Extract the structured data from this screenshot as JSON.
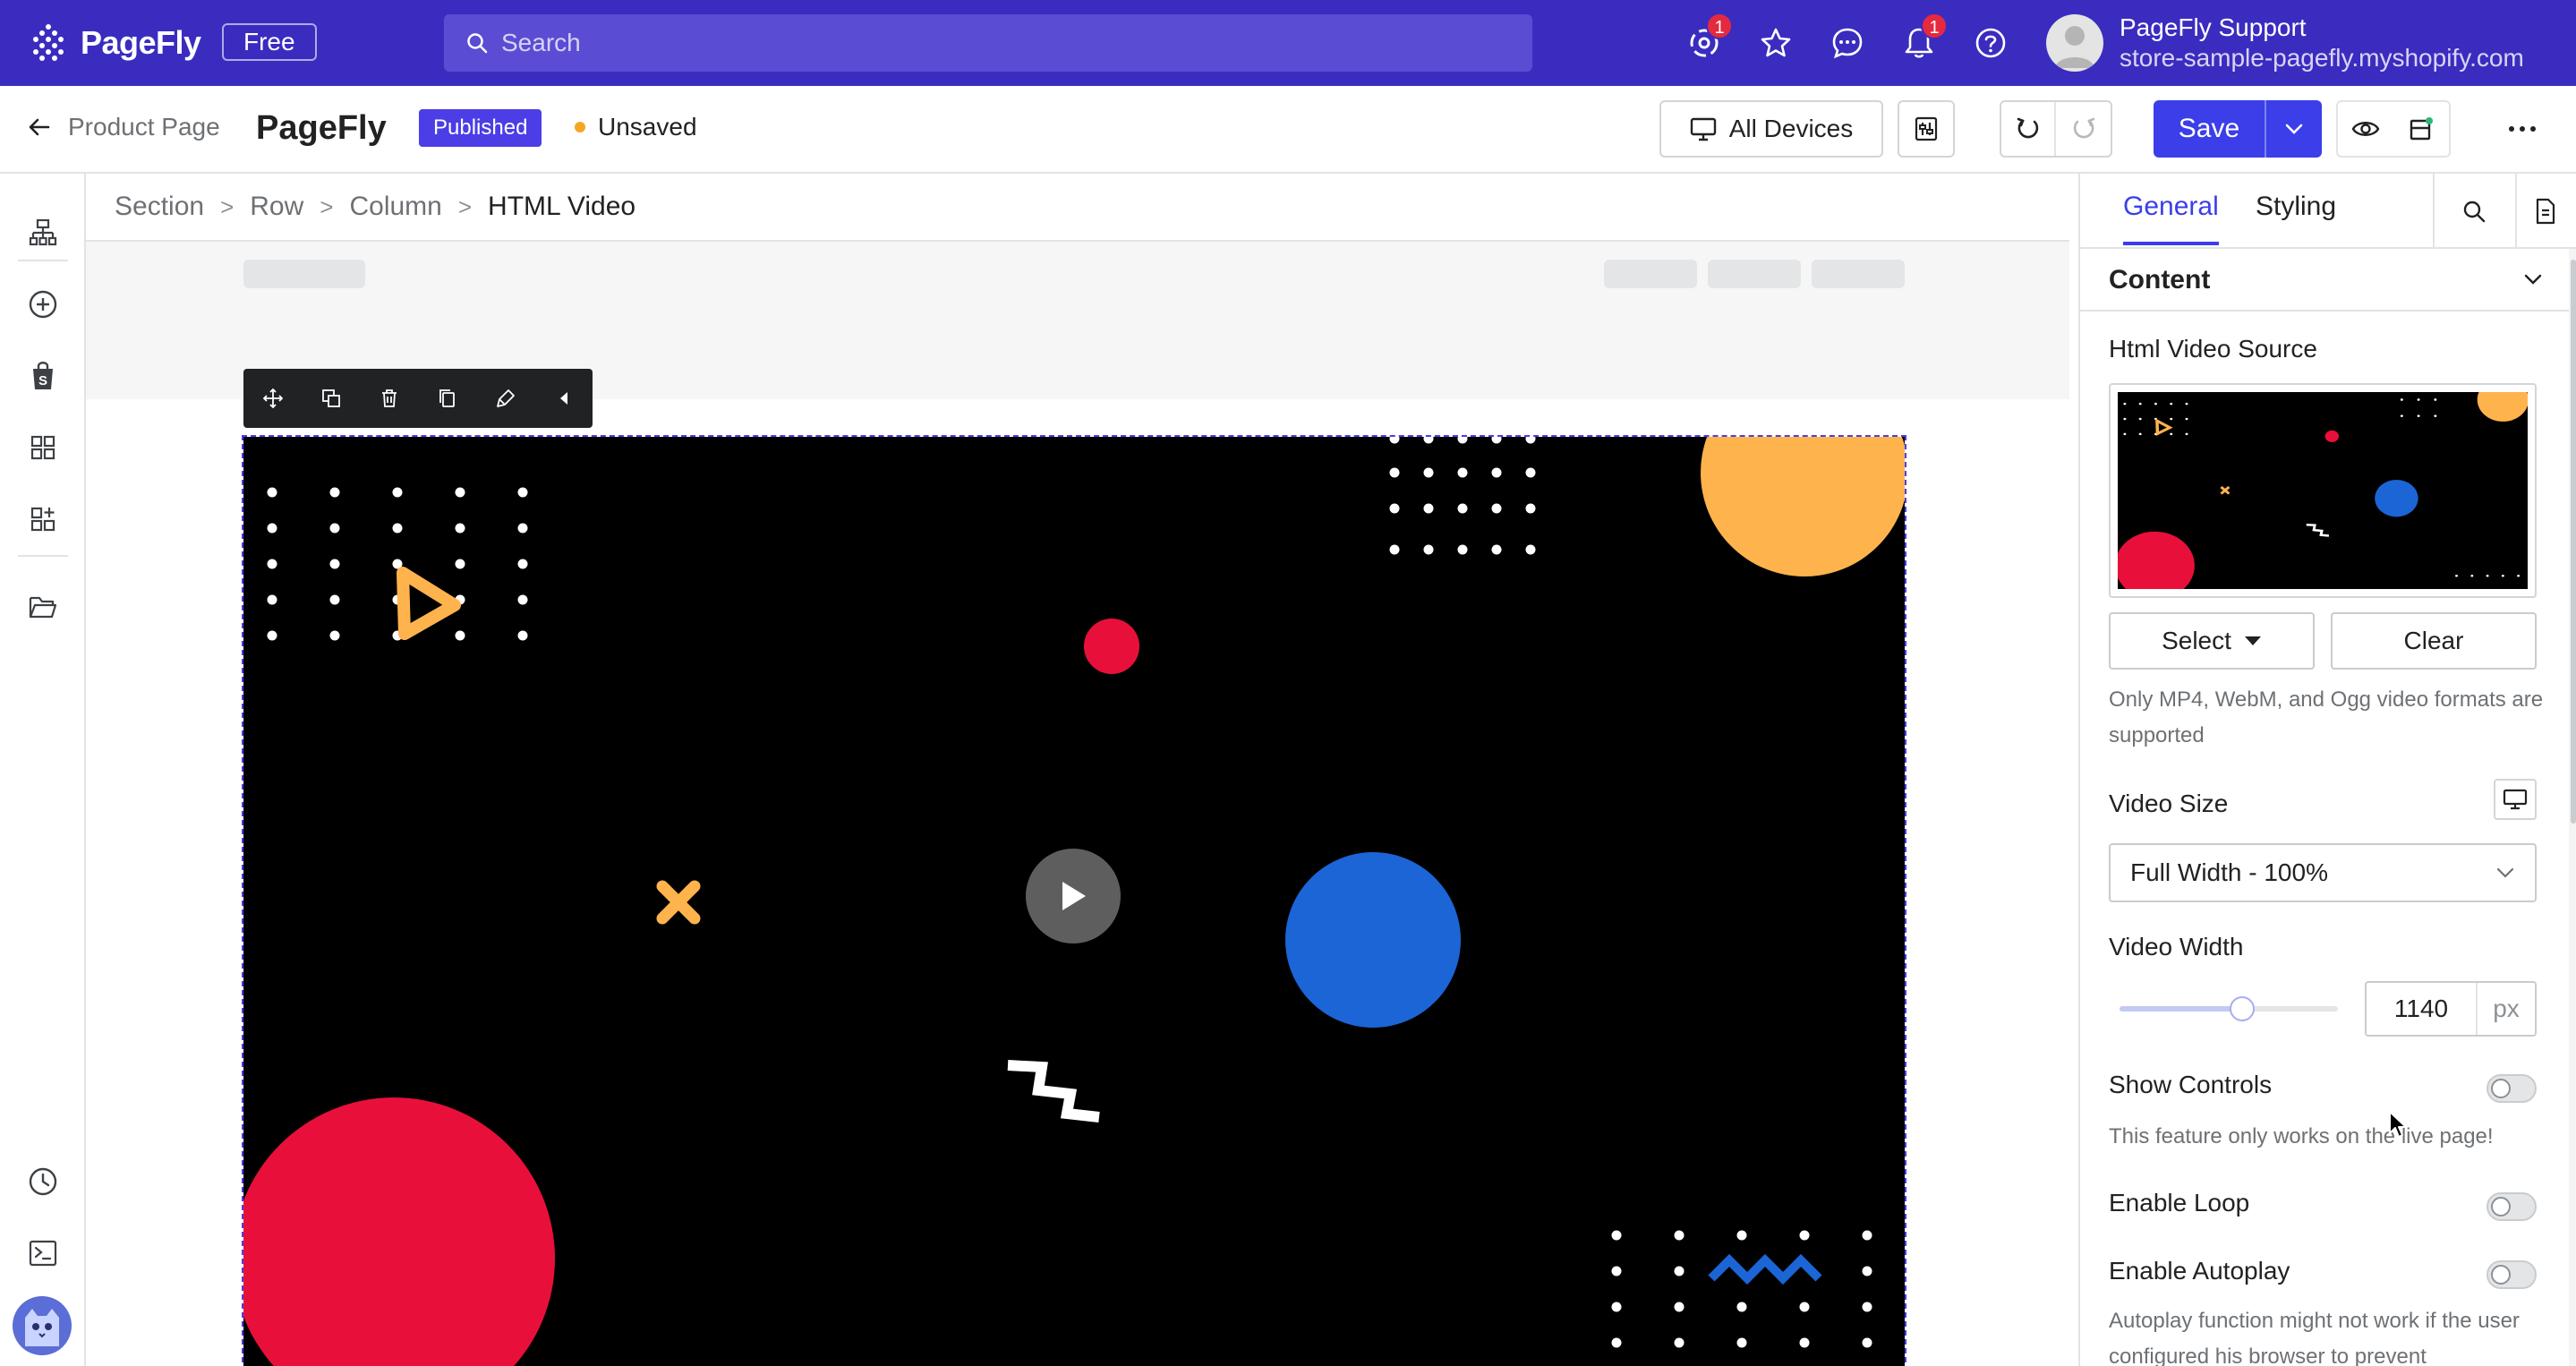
{
  "topbar": {
    "brand": "PageFly",
    "plan": "Free",
    "search_placeholder": "Search",
    "icons": [
      {
        "name": "apps-icon",
        "badge": "1"
      },
      {
        "name": "star-icon"
      },
      {
        "name": "chat-icon"
      },
      {
        "name": "bell-icon",
        "badge": "1"
      },
      {
        "name": "help-icon"
      }
    ],
    "account_name": "PageFly Support",
    "account_store": "store-sample-pagefly.myshopify.com"
  },
  "toolbar": {
    "back_label": "Product Page",
    "page_name": "PageFly",
    "status": "Published",
    "save_state": "Unsaved",
    "device_label": "All Devices",
    "save_label": "Save"
  },
  "canvas": {
    "breadcrumb": [
      "Section",
      "Row",
      "Column",
      "HTML Video"
    ],
    "element_tools": [
      "move-icon",
      "duplicate-icon",
      "delete-icon",
      "copy-icon",
      "style-icon",
      "collapse-icon"
    ]
  },
  "panel": {
    "tabs": [
      "General",
      "Styling"
    ],
    "section_title": "Content",
    "source_label": "Html Video Source",
    "select_label": "Select",
    "clear_label": "Clear",
    "formats_note": "Only MP4, WebM, and Ogg video formats are supported",
    "size_label": "Video Size",
    "size_value": "Full Width - 100%",
    "width_label": "Video Width",
    "width_value": "1140",
    "width_unit": "px",
    "width_slider_fraction": 0.56,
    "show_controls_label": "Show Controls",
    "show_controls_on": false,
    "controls_note": "This feature only works on the live page!",
    "loop_label": "Enable Loop",
    "loop_on": false,
    "autoplay_label": "Enable Autoplay",
    "autoplay_on": false,
    "autoplay_note": "Autoplay function might not work if the user configured his browser to prevent"
  },
  "colors": {
    "brand": "#3b2cc0",
    "accent": "#3b3ee9",
    "video_red": "#e8103a",
    "video_orange": "#ffb34d",
    "video_blue": "#1b65d6"
  }
}
